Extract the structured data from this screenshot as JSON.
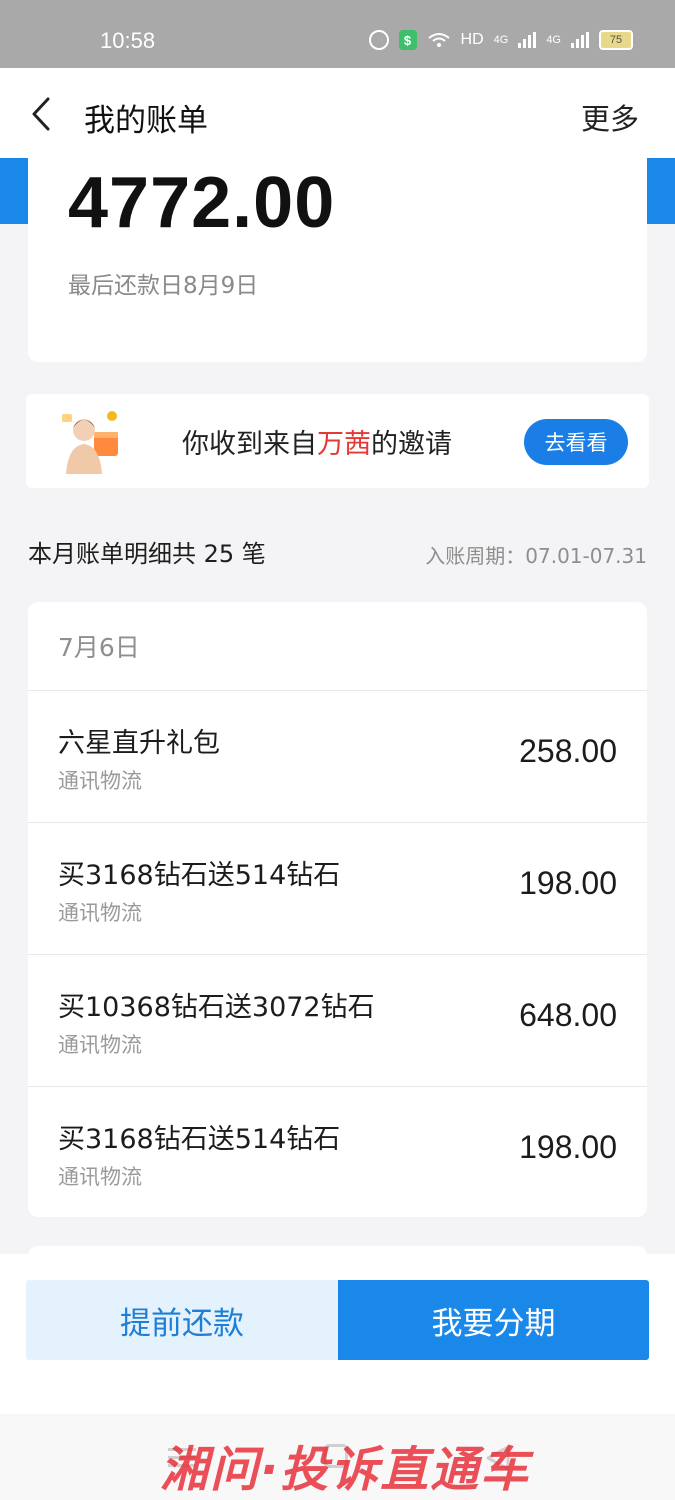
{
  "status_bar": {
    "time": "10:58",
    "network": "HD",
    "signal1": "4G",
    "signal2": "4G",
    "battery": "75"
  },
  "header": {
    "title": "我的账单",
    "more": "更多"
  },
  "summary_card": {
    "amount": "4772.00",
    "due_date": "最后还款日8月9日"
  },
  "invite": {
    "text_prefix": "你收到来自",
    "highlight": "万茜",
    "text_suffix": "的邀请",
    "button": "去看看"
  },
  "bill_summary": {
    "count_text": "本月账单明细共 25 笔",
    "period": "入账周期：07.01-07.31"
  },
  "bills": {
    "date": "7月6日",
    "items": [
      {
        "name": "六星直升礼包",
        "category": "通讯物流",
        "amount": "258.00"
      },
      {
        "name": "买3168钻石送514钻石",
        "category": "通讯物流",
        "amount": "198.00"
      },
      {
        "name": "买10368钻石送3072钻石",
        "category": "通讯物流",
        "amount": "648.00"
      },
      {
        "name": "买3168钻石送514钻石",
        "category": "通讯物流",
        "amount": "198.00"
      }
    ]
  },
  "actions": {
    "prepay": "提前还款",
    "installment": "我要分期"
  },
  "watermark": "湘问·投诉直通车",
  "colors": {
    "accent": "#1a88e8",
    "highlight": "#e53935",
    "status_bar": "#a9a9a9"
  }
}
